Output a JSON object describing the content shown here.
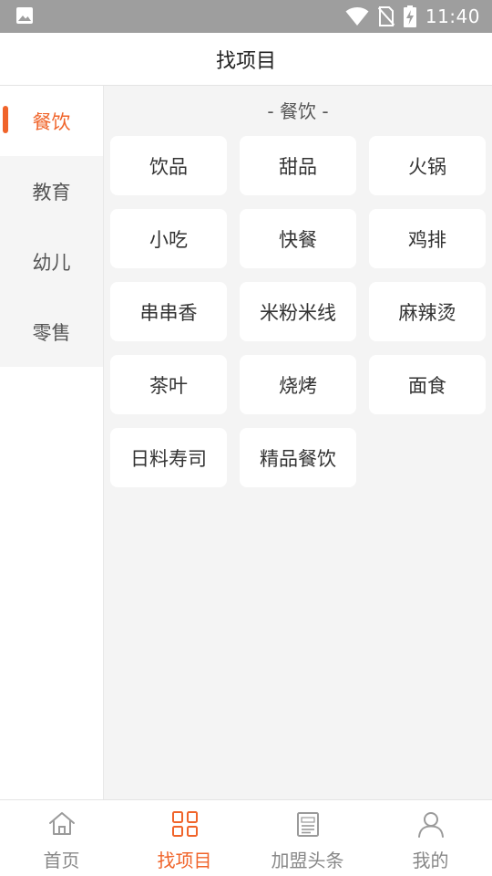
{
  "status_bar": {
    "time": "11:40",
    "icons": [
      "image-icon",
      "wifi-icon",
      "no-sim-icon",
      "battery-charging-icon"
    ]
  },
  "header": {
    "title": "找项目"
  },
  "sidebar": {
    "items": [
      {
        "label": "餐饮",
        "active": true
      },
      {
        "label": "教育",
        "active": false
      },
      {
        "label": "幼儿",
        "active": false
      },
      {
        "label": "零售",
        "active": false
      }
    ]
  },
  "main": {
    "section_title": "- 餐饮 -",
    "categories": [
      "饮品",
      "甜品",
      "火锅",
      "小吃",
      "快餐",
      "鸡排",
      "串串香",
      "米粉米线",
      "麻辣烫",
      "茶叶",
      "烧烤",
      "面食",
      "日料寿司",
      "精品餐饮"
    ]
  },
  "bottom_nav": {
    "tabs": [
      {
        "label": "首页",
        "icon": "home-icon",
        "active": false
      },
      {
        "label": "找项目",
        "icon": "grid-icon",
        "active": true
      },
      {
        "label": "加盟头条",
        "icon": "news-icon",
        "active": false
      },
      {
        "label": "我的",
        "icon": "user-icon",
        "active": false
      }
    ]
  },
  "colors": {
    "accent": "#f0642a",
    "status_bar": "#9e9e9e",
    "panel_bg": "#f4f4f4"
  }
}
